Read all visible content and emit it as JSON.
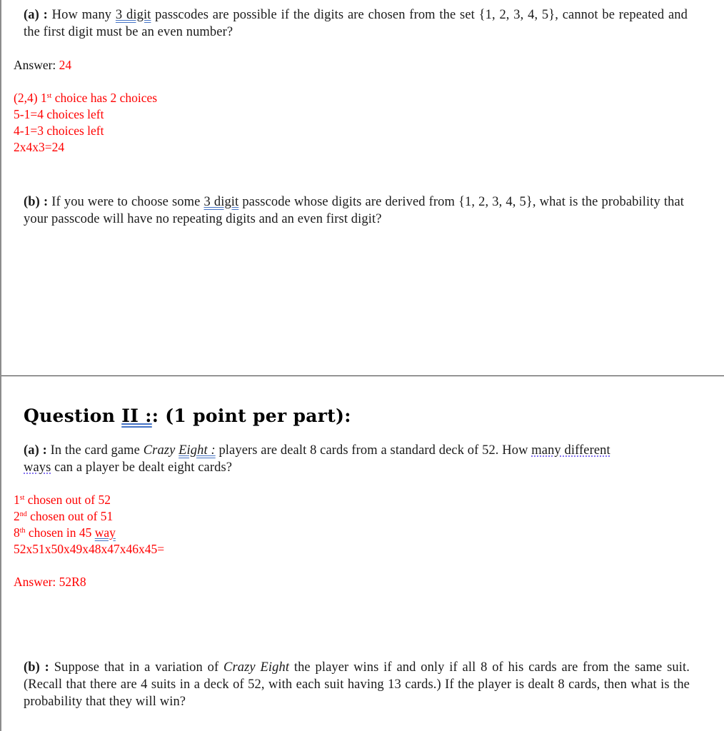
{
  "section1": {
    "part_a": {
      "label": "(a)",
      "sep": " : ",
      "text_1": "How many ",
      "underlined": "3 digit",
      "text_2": " passcodes are possible if the digits are chosen from the set {1, 2, 3, 4, 5}, cannot be repeated and the first digit must be an even number?"
    },
    "answer_a": {
      "label": "Answer: ",
      "value": "24"
    },
    "work_a": [
      {
        "pre": "(2,4) 1",
        "sup": "st",
        "post": " choice has 2 choices"
      },
      {
        "pre": "5-1=4 choices left",
        "sup": "",
        "post": ""
      },
      {
        "pre": "4-1=3 choices left",
        "sup": "",
        "post": ""
      },
      {
        "pre": "2x4x3=24",
        "sup": "",
        "post": ""
      }
    ],
    "part_b": {
      "label": "(b)",
      "sep": " : ",
      "text_1": "If you were to choose some ",
      "underlined": "3 digit",
      "text_2": " passcode whose digits are derived from {1, 2, 3, 4, 5}, what is the probability that your passcode will have no repeating digits and an even first digit?"
    }
  },
  "section2": {
    "heading": {
      "pre": "Question ",
      "underlined": "II :",
      "post": ": (1 point per part):"
    },
    "part_a": {
      "label": "(a)",
      "sep": " : ",
      "text_1": "In the card game ",
      "italic_1": "Crazy ",
      "italic_underlined": "Eight :",
      "text_2": " players are dealt 8 cards from a standard deck of 52.  How ",
      "dotted": "many different",
      "text_3": " ",
      "dotted_2": "ways",
      "text_4": " can a player be dealt eight cards?"
    },
    "work_a": [
      {
        "pre": "1",
        "sup": "st",
        "post": " chosen out of 52",
        "underlined": ""
      },
      {
        "pre": "2",
        "sup": "nd",
        "post": " chosen out of 51",
        "underlined": ""
      },
      {
        "pre": "8",
        "sup": "th",
        "post": " chosen in 45 ",
        "underlined": "way"
      },
      {
        "pre": "52x51x50x49x48x47x46x45=",
        "sup": "",
        "post": "",
        "underlined": ""
      }
    ],
    "answer_a": {
      "label": "Answer: 52R8"
    },
    "part_b": {
      "label": "(b)",
      "sep": " : ",
      "text_1": "Suppose that in a variation of ",
      "italic": "Crazy Eight",
      "text_2": " the player wins if and only if all 8 of his cards are from the same suit. (Recall that there are 4 suits in a deck of 52, with each suit having 13 cards.)  If the player is dealt 8 cards, then what is the probability that they will win?"
    }
  }
}
